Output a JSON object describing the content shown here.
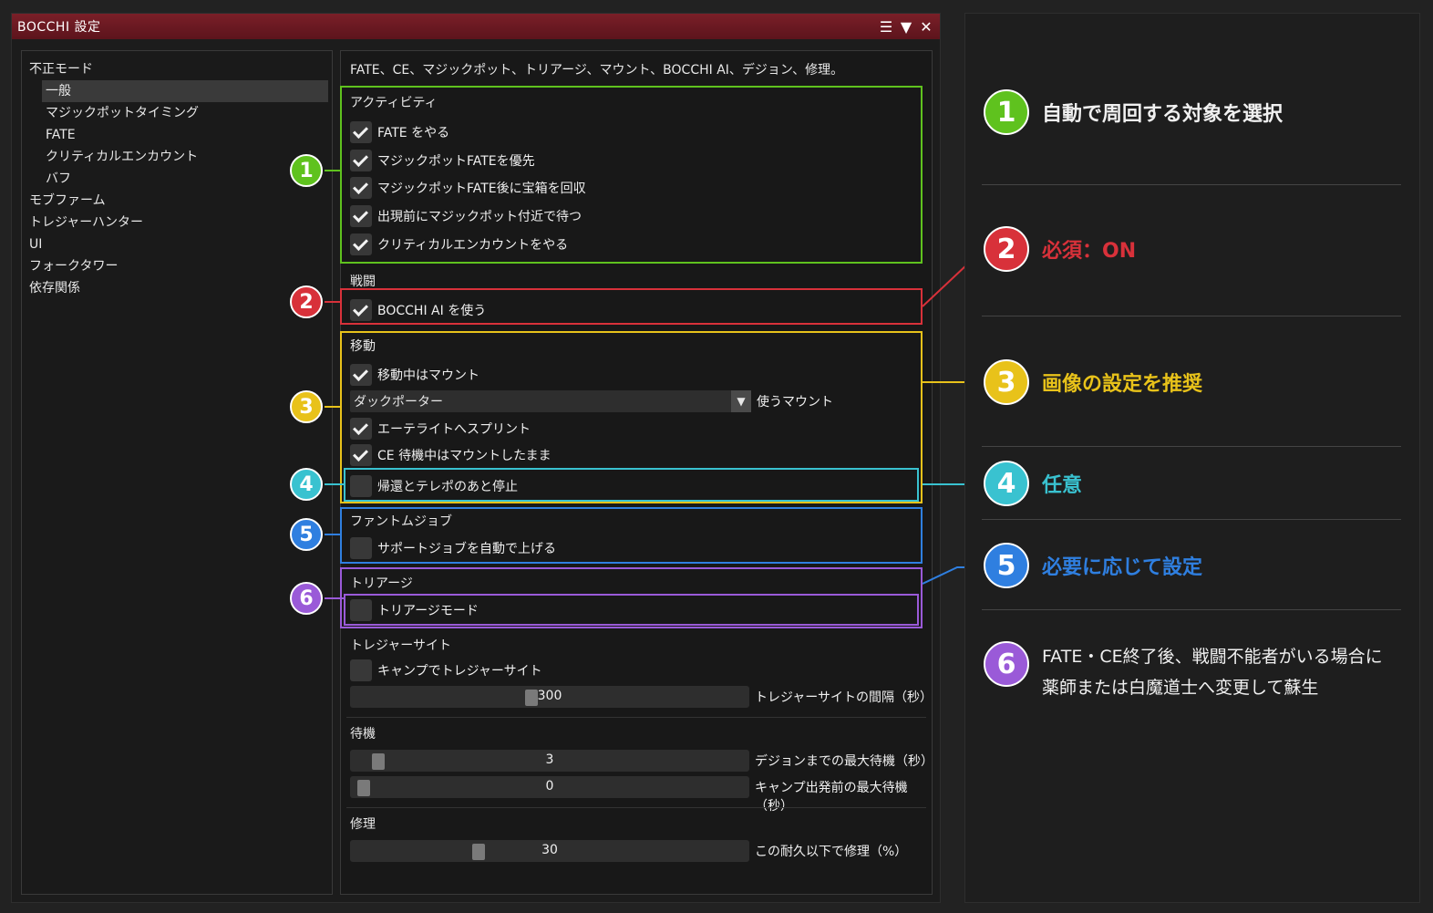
{
  "window": {
    "title": "BOCCHI 設定",
    "controls": [
      "☰",
      "▼",
      "✕"
    ]
  },
  "nav": {
    "items": [
      {
        "label": "不正モード",
        "level": 0
      },
      {
        "label": "一般",
        "level": 1,
        "active": true
      },
      {
        "label": "マジックポットタイミング",
        "level": 1
      },
      {
        "label": "FATE",
        "level": 1
      },
      {
        "label": "クリティカルエンカウント",
        "level": 1
      },
      {
        "label": "バフ",
        "level": 1
      },
      {
        "label": "モブファーム",
        "level": 0
      },
      {
        "label": "トレジャーハンター",
        "level": 0
      },
      {
        "label": "UI",
        "level": 0
      },
      {
        "label": "フォークタワー",
        "level": 0
      },
      {
        "label": "依存関係",
        "level": 0
      }
    ]
  },
  "content": {
    "description": "FATE、CE、マジックポット、トリアージ、マウント、BOCCHI AI、デジョン、修理。",
    "activity": {
      "heading": "アクティビティ",
      "options": [
        {
          "label": "FATE をやる",
          "checked": true
        },
        {
          "label": "マジックポットFATEを優先",
          "checked": true
        },
        {
          "label": "マジックポットFATE後に宝箱を回収",
          "checked": true
        },
        {
          "label": "出現前にマジックポット付近で待つ",
          "checked": true
        },
        {
          "label": "クリティカルエンカウントをやる",
          "checked": true
        }
      ]
    },
    "combat": {
      "heading": "戦闘",
      "option": {
        "label": "BOCCHI AI を使う",
        "checked": true
      }
    },
    "movement": {
      "heading": "移動",
      "mount_while_moving": {
        "label": "移動中はマウント",
        "checked": true
      },
      "mount_select": {
        "value": "ダックポーター",
        "label": "使うマウント"
      },
      "aetherite_sprint": {
        "label": "エーテライトへスプリント",
        "checked": true
      },
      "stay_mounted_ce": {
        "label": "CE 待機中はマウントしたまま",
        "checked": true
      },
      "stop_after_return": {
        "label": "帰還とテレポのあと停止",
        "checked": false
      }
    },
    "phantom_job": {
      "heading": "ファントムジョブ",
      "option": {
        "label": "サポートジョブを自動で上げる",
        "checked": false
      }
    },
    "triage": {
      "heading": "トリアージ",
      "option": {
        "label": "トリアージモード",
        "checked": false
      }
    },
    "treasure_sight": {
      "heading": "トレジャーサイト",
      "option": {
        "label": "キャンプでトレジャーサイト",
        "checked": false
      },
      "interval": {
        "value": "300",
        "label": "トレジャーサイトの間隔（秒）",
        "fraction": 0.45
      }
    },
    "wait": {
      "heading": "待機",
      "max_before_dejon": {
        "value": "3",
        "label": "デジョンまでの最大待機（秒）",
        "fraction": 0.04
      },
      "max_before_camp": {
        "value": "0",
        "label": "キャンプ出発前の最大待機（秒）",
        "fraction": 0.0
      }
    },
    "repair": {
      "heading": "修理",
      "threshold": {
        "value": "30",
        "label": "この耐久以下で修理（%）",
        "fraction": 0.31
      }
    }
  },
  "callouts": [
    {
      "num": "1",
      "text": "自動で周回する対象を選択",
      "color": "#5fc21e"
    },
    {
      "num": "2",
      "text": "必須：ON",
      "color": "#d8313a"
    },
    {
      "num": "3",
      "text": "画像の設定を推奨",
      "color": "#e8c21a"
    },
    {
      "num": "4",
      "text": "任意",
      "color": "#39c2d0"
    },
    {
      "num": "5",
      "text": "必要に応じて設定",
      "color": "#2f7fe0"
    },
    {
      "num": "6",
      "text_line1": "FATE・CE終了後、戦闘不能者がいる場合に",
      "text_line2": "薬師または白魔道士へ変更して蘇生",
      "color": "#9a5ad8"
    }
  ]
}
